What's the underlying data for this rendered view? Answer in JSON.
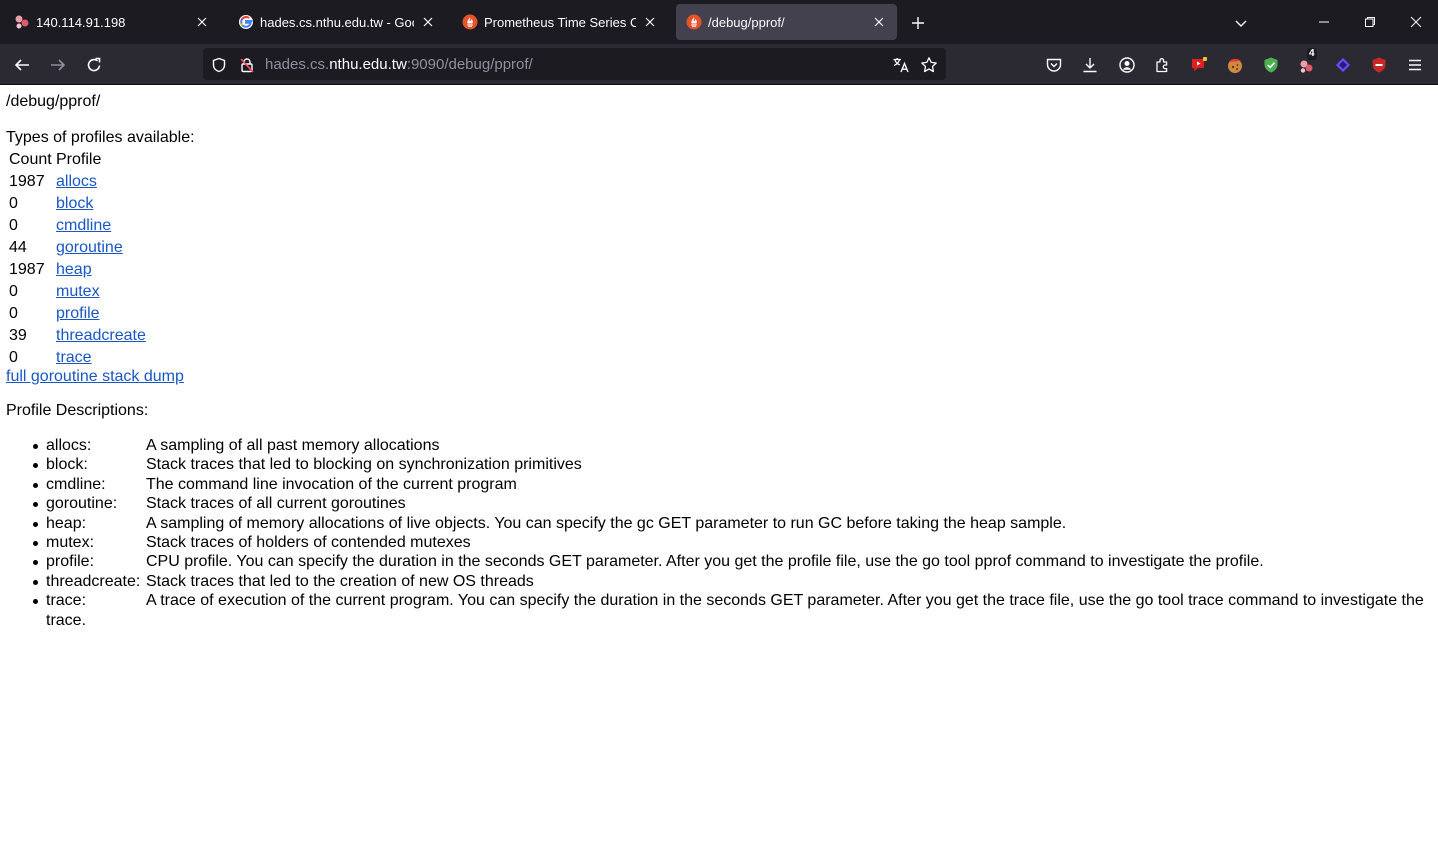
{
  "browser": {
    "tabs": [
      {
        "title": "140.114.91.198",
        "favicon": "prometheus-cluster-icon",
        "active": false
      },
      {
        "title": "hades.cs.nthu.edu.tw - Google",
        "favicon": "google-icon",
        "active": false
      },
      {
        "title": "Prometheus Time Series Colle",
        "favicon": "prometheus-icon",
        "active": false
      },
      {
        "title": "/debug/pprof/",
        "favicon": "prometheus-icon",
        "active": true
      }
    ],
    "url": {
      "prefix": "hades.cs.",
      "domain": "nthu.edu.tw",
      "suffix": ":9090/debug/pprof/"
    },
    "extensions": {
      "badge_count": "4"
    },
    "colors": {
      "tabbar": "#1c1b22",
      "toolbar": "#2b2a33",
      "active_tab": "#42414d",
      "link": "#1a56c4"
    }
  },
  "page": {
    "title": "/debug/pprof/",
    "types_heading": "Types of profiles available:",
    "table": {
      "headers": [
        "Count",
        "Profile"
      ],
      "rows": [
        {
          "count": "1987",
          "profile": "allocs"
        },
        {
          "count": "0",
          "profile": "block"
        },
        {
          "count": "0",
          "profile": "cmdline"
        },
        {
          "count": "44",
          "profile": "goroutine"
        },
        {
          "count": "1987",
          "profile": "heap"
        },
        {
          "count": "0",
          "profile": "mutex"
        },
        {
          "count": "0",
          "profile": "profile"
        },
        {
          "count": "39",
          "profile": "threadcreate"
        },
        {
          "count": "0",
          "profile": "trace"
        }
      ]
    },
    "stack_dump_link": "full goroutine stack dump",
    "descriptions_heading": "Profile Descriptions:",
    "descriptions": [
      {
        "name": "allocs:",
        "text": "A sampling of all past memory allocations"
      },
      {
        "name": "block:",
        "text": "Stack traces that led to blocking on synchronization primitives"
      },
      {
        "name": "cmdline:",
        "text": "The command line invocation of the current program"
      },
      {
        "name": "goroutine:",
        "text": "Stack traces of all current goroutines"
      },
      {
        "name": "heap:",
        "text": "A sampling of memory allocations of live objects. You can specify the gc GET parameter to run GC before taking the heap sample."
      },
      {
        "name": "mutex:",
        "text": "Stack traces of holders of contended mutexes"
      },
      {
        "name": "profile:",
        "text": "CPU profile. You can specify the duration in the seconds GET parameter. After you get the profile file, use the go tool pprof command to investigate the profile."
      },
      {
        "name": "threadcreate:",
        "text": "Stack traces that led to the creation of new OS threads"
      },
      {
        "name": "trace:",
        "text": "A trace of execution of the current program. You can specify the duration in the seconds GET parameter. After you get the trace file, use the go tool trace command to investigate the",
        "continuation": "trace."
      }
    ]
  }
}
